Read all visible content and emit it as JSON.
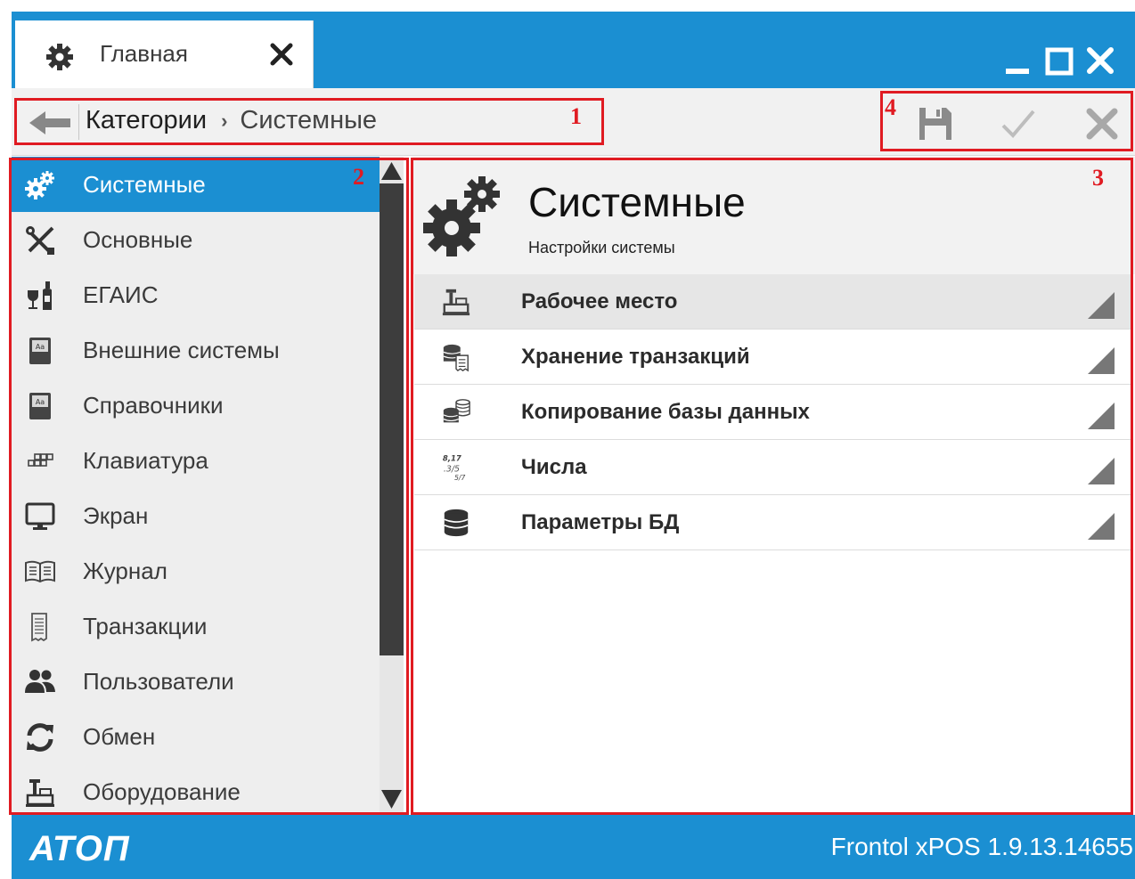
{
  "window": {
    "tab_label": "Главная",
    "icons": [
      "gear-icon",
      "close-icon",
      "minimize-icon",
      "maximize-icon",
      "window-close-icon"
    ]
  },
  "breadcrumb": {
    "item1": "Категории",
    "separator": "›",
    "item2": "Системные"
  },
  "annotations": {
    "n1": "1",
    "n2": "2",
    "n3": "3",
    "n4": "4",
    "color": "#e01b22"
  },
  "toolbar": {
    "buttons": [
      "save-icon",
      "apply-check-icon",
      "cancel-x-icon"
    ]
  },
  "sidebar": {
    "items": [
      {
        "label": "Системные",
        "icon": "gears-icon",
        "active": true
      },
      {
        "label": "Основные",
        "icon": "tools-icon"
      },
      {
        "label": "ЕГАИС",
        "icon": "wine-icon"
      },
      {
        "label": "Внешние системы",
        "icon": "book-icon"
      },
      {
        "label": "Справочники",
        "icon": "book-icon"
      },
      {
        "label": "Клавиатура",
        "icon": "keyboard-icon"
      },
      {
        "label": "Экран",
        "icon": "monitor-icon"
      },
      {
        "label": "Журнал",
        "icon": "journal-icon"
      },
      {
        "label": "Транзакции",
        "icon": "receipt-icon"
      },
      {
        "label": "Пользователи",
        "icon": "users-icon"
      },
      {
        "label": "Обмен",
        "icon": "sync-icon"
      },
      {
        "label": "Оборудование",
        "icon": "cash-register-icon"
      }
    ]
  },
  "content": {
    "title": "Системные",
    "subtitle": "Настройки системы",
    "rows": [
      {
        "label": "Рабочее место",
        "icon": "cash-register-icon"
      },
      {
        "label": "Хранение транзакций",
        "icon": "db-receipt-icon"
      },
      {
        "label": "Копирование базы данных",
        "icon": "db-copy-icon"
      },
      {
        "label": "Числа",
        "icon": "numbers-icon"
      },
      {
        "label": "Параметры БД",
        "icon": "database-icon"
      }
    ]
  },
  "footer": {
    "logo": "АТОП",
    "version": "Frontol xPOS 1.9.13.14655"
  },
  "colors": {
    "accent": "#1b8fd2",
    "annotation": "#e01b22",
    "scroll_thumb": "#3d3d3d"
  }
}
